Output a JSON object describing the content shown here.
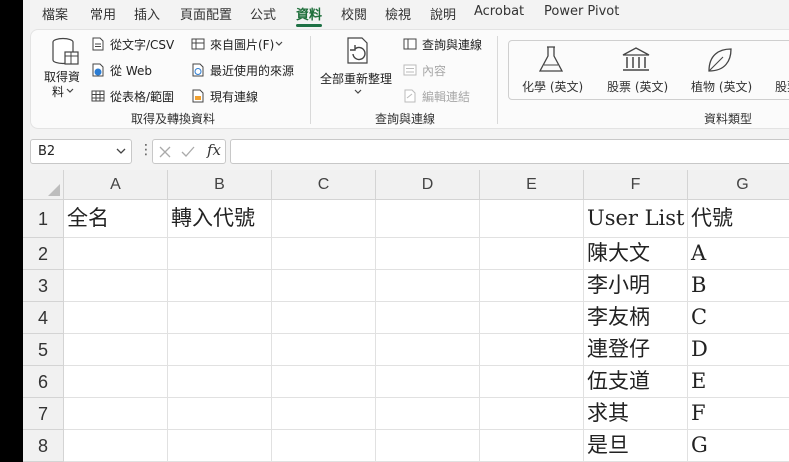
{
  "menu": {
    "tabs": [
      {
        "label": "檔案"
      },
      {
        "label": "常用"
      },
      {
        "label": "插入"
      },
      {
        "label": "頁面配置"
      },
      {
        "label": "公式"
      },
      {
        "label": "資料",
        "active": true
      },
      {
        "label": "校閱"
      },
      {
        "label": "檢視"
      },
      {
        "label": "說明"
      },
      {
        "label": "Acrobat"
      },
      {
        "label": "Power Pivot"
      }
    ]
  },
  "ribbon": {
    "get_transform": {
      "get_data": "取得資料",
      "get_data_line1": "取得資",
      "get_data_line2": "料",
      "from_text_csv": "從文字/CSV",
      "from_web": "從 Web",
      "from_table_range": "從表格/範圍",
      "from_picture": "來自圖片(F)",
      "recent_sources": "最近使用的來源",
      "existing_connections": "現有連線",
      "group_label": "取得及轉換資料"
    },
    "queries": {
      "refresh_all": "全部重新整理",
      "queries_connections": "查詢與連線",
      "properties": "內容",
      "edit_links": "編輯連結",
      "group_label": "查詢與連線"
    },
    "data_types": {
      "items": [
        "化學 (英文)",
        "股票 (英文)",
        "植物 (英文)",
        "股票"
      ],
      "group_label": "資料類型"
    }
  },
  "formula_bar": {
    "name_box": "B2",
    "fx_label": "fx",
    "formula": ""
  },
  "grid": {
    "columns": [
      "A",
      "B",
      "C",
      "D",
      "E",
      "F",
      "G"
    ],
    "rows": [
      {
        "n": "1",
        "cells": [
          "全名",
          "轉入代號",
          "",
          "",
          "",
          "User List",
          "代號"
        ]
      },
      {
        "n": "2",
        "cells": [
          "",
          "",
          "",
          "",
          "",
          "陳大文",
          "A"
        ]
      },
      {
        "n": "3",
        "cells": [
          "",
          "",
          "",
          "",
          "",
          "李小明",
          "B"
        ]
      },
      {
        "n": "4",
        "cells": [
          "",
          "",
          "",
          "",
          "",
          "李友柄",
          "C"
        ]
      },
      {
        "n": "5",
        "cells": [
          "",
          "",
          "",
          "",
          "",
          "連登仔",
          "D"
        ]
      },
      {
        "n": "6",
        "cells": [
          "",
          "",
          "",
          "",
          "",
          "伍支道",
          "E"
        ]
      },
      {
        "n": "7",
        "cells": [
          "",
          "",
          "",
          "",
          "",
          "求其",
          "F"
        ]
      },
      {
        "n": "8",
        "cells": [
          "",
          "",
          "",
          "",
          "",
          "是旦",
          "G"
        ]
      }
    ]
  },
  "colors": {
    "accent": "#1e7145",
    "grid_line": "#e1e1e1",
    "header_bg": "#f1f1f1"
  }
}
